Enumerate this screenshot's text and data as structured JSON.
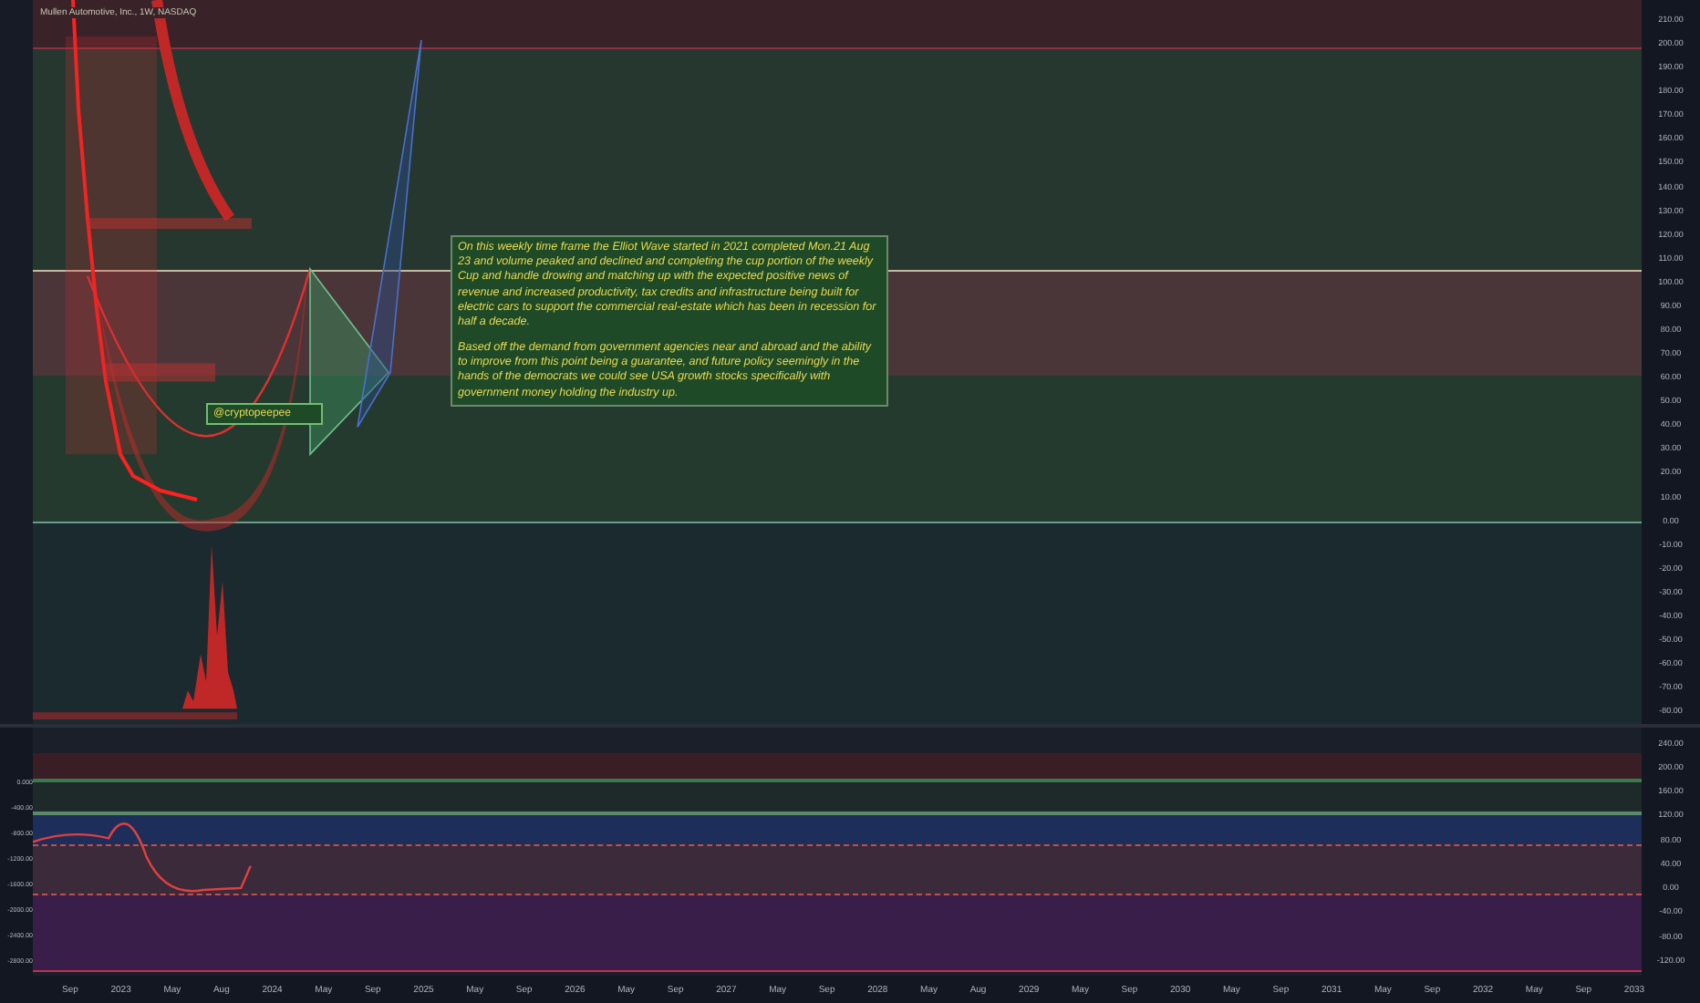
{
  "chart": {
    "title": "Mullen Automotive, Inc., 1W, NASDAQ",
    "tag": "@cryptopeepee",
    "annotation": [
      "On this weekly time frame the Elliot Wave started in 2021 completed Mon.21 Aug 23 and volume peaked and declined and completing the cup portion of the weekly Cup and handle drowing and matching up with the expected positive news of revenue and increased productivity, tax credits and  infrastructure being built for electric cars to support the commercial real-estate which has been in recession for half a decade.",
      "Based off the demand from government agencies near and abroad and the ability to improve from this point being a guarantee, and future policy seemingly in the hands of the democrats we could see USA growth stocks specifically with government money holding the industry up."
    ],
    "price_axis": [
      "210.00",
      "200.00",
      "190.00",
      "180.00",
      "170.00",
      "160.00",
      "150.00",
      "140.00",
      "130.00",
      "120.00",
      "110.00",
      "100.00",
      "90.00",
      "80.00",
      "70.00",
      "60.00",
      "50.00",
      "40.00",
      "30.00",
      "20.00",
      "10.00",
      "0.00",
      "-10.00",
      "-20.00",
      "-30.00",
      "-40.00",
      "-50.00",
      "-60.00",
      "-70.00",
      "-80.00"
    ]
  },
  "indicator": {
    "left_axis": [
      "0.000",
      "-400.00",
      "-800.00",
      "-1200.00",
      "-1600.00",
      "-2000.00",
      "-2400.00",
      "-2800.00"
    ],
    "right_axis": [
      "240.00",
      "200.00",
      "160.00",
      "120.00",
      "80.00",
      "40.00",
      "0.00",
      "-40.00",
      "-80.00",
      "-120.00"
    ]
  },
  "time_axis": [
    "Sep",
    "2023",
    "May",
    "Aug",
    "2024",
    "May",
    "Sep",
    "2025",
    "May",
    "Sep",
    "2026",
    "May",
    "Sep",
    "2027",
    "May",
    "Sep",
    "2028",
    "May",
    "Aug",
    "2029",
    "May",
    "Sep",
    "2030",
    "May",
    "Sep",
    "2031",
    "May",
    "Sep",
    "2032",
    "May",
    "Sep",
    "2033"
  ]
}
